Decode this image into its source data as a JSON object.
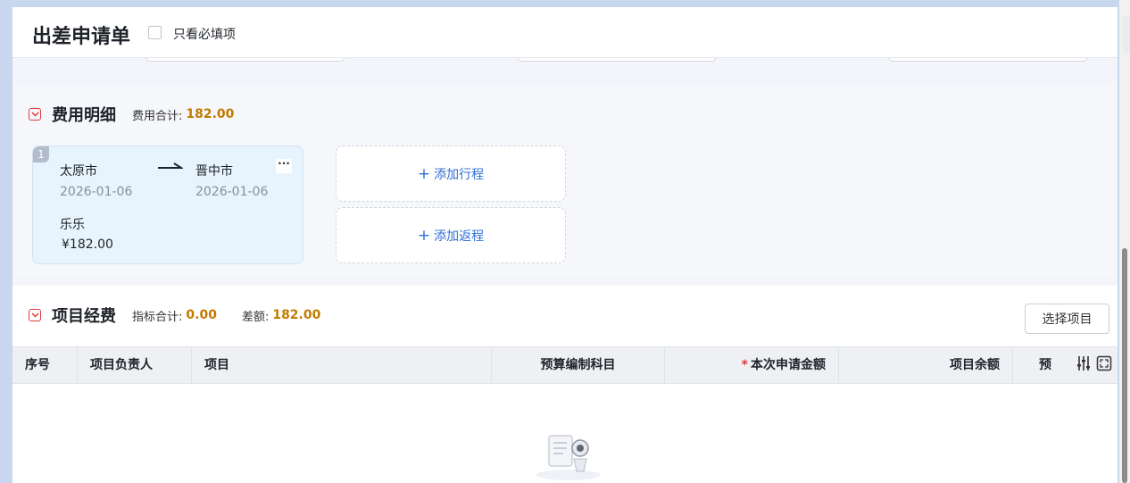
{
  "header": {
    "title": "出差申请单",
    "required_only_label": "只看必填项"
  },
  "fee_section": {
    "title": "费用明细",
    "total_label": "费用合计:",
    "total_value": "182.00",
    "trip": {
      "index": "1",
      "from_city": "太原市",
      "to_city": "晋中市",
      "from_date": "2026-01-06",
      "to_date": "2026-01-06",
      "traveler": "乐乐",
      "amount": "¥182.00",
      "more_label": "···"
    },
    "add_outbound_label": "添加行程",
    "add_return_label": "添加返程"
  },
  "project_section": {
    "title": "项目经费",
    "indicator_total_label": "指标合计:",
    "indicator_total_value": "0.00",
    "difference_label": "差额:",
    "difference_value": "182.00",
    "select_button_label": "选择项目",
    "columns": [
      "序号",
      "项目负责人",
      "项目",
      "预算编制科目",
      "本次申请金额",
      "项目余额",
      "预"
    ],
    "required_star": "*"
  },
  "colors": {
    "accent_blue": "#2f6fd6",
    "amount_orange": "#c07a00",
    "required_red": "#e03a3a"
  },
  "icons": [
    "collapse-icon",
    "arrow-right-icon",
    "more-icon",
    "plus-icon",
    "column-settings-icon",
    "fullscreen-icon",
    "empty-data-icon"
  ]
}
